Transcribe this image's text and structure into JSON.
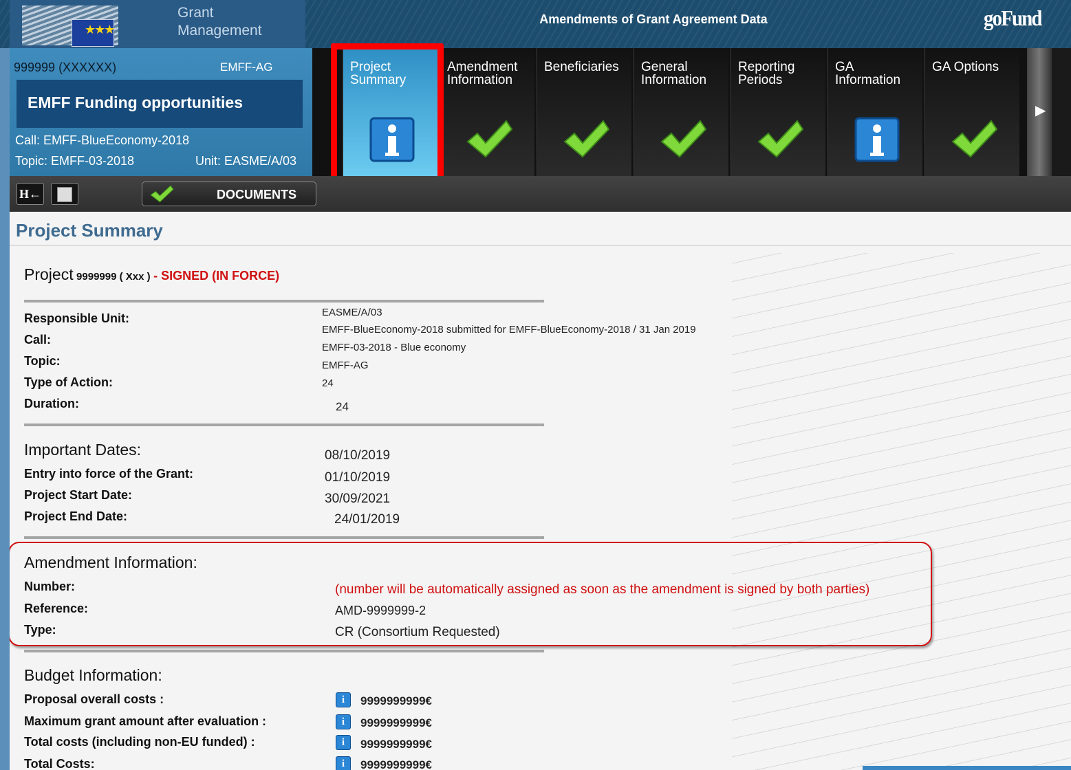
{
  "header": {
    "app_title_line1": "Grant",
    "app_title_line2": "Management",
    "page_heading": "Amendments of Grant Agreement Data",
    "brand_logo": "goFund"
  },
  "project_box": {
    "id": "999999 (XXXXXX)",
    "programme": "EMFF-AG",
    "title": "EMFF  Funding opportunities",
    "call": "Call: EMFF-BlueEconomy-2018",
    "topic": "Topic: EMFF-03-2018",
    "unit": "Unit: EASME/A/03"
  },
  "steps": [
    {
      "line1": "Project",
      "line2": "Summary",
      "icon": "info-icon",
      "active": true
    },
    {
      "line1": "Amendment",
      "line2": "Information",
      "icon": "check-icon",
      "active": false
    },
    {
      "line1": "Beneficiaries",
      "line2": "",
      "icon": "check-icon",
      "active": false
    },
    {
      "line1": "General",
      "line2": "Information",
      "icon": "check-icon",
      "active": false
    },
    {
      "line1": "Reporting",
      "line2": "Periods",
      "icon": "check-icon",
      "active": false
    },
    {
      "line1": "GA",
      "line2": "Information",
      "icon": "info-icon",
      "active": false
    },
    {
      "line1": "GA Options",
      "line2": "",
      "icon": "check-icon",
      "active": false
    }
  ],
  "toolbar": {
    "home_label": "H←",
    "documents_label": "DOCUMENTS"
  },
  "summary": {
    "section_title": "Project Summary",
    "project_word": "Project",
    "project_number": "9999999 ( Xxx )",
    "project_status": " - SIGNED (IN FORCE)",
    "general_labels": [
      "Responsible Unit:",
      "Call:",
      "Topic:",
      "Type of Action:",
      "Duration:"
    ],
    "general_values": [
      "EASME/A/03",
      "EMFF-BlueEconomy-2018 submitted for EMFF-BlueEconomy-2018 / 31 Jan 2019",
      "EMFF-03-2018 - Blue economy",
      "EMFF-AG",
      "24",
      "24"
    ],
    "dates_header": "Important Dates:",
    "dates_labels": [
      "Entry into force of the Grant:",
      "Project Start Date:",
      "Project End Date:"
    ],
    "dates_values": [
      "08/10/2019",
      "01/10/2019",
      "30/09/2021",
      "24/01/2019"
    ],
    "amend_header": "Amendment Information:",
    "amend_labels": [
      "Number:",
      "Reference:",
      "Type:"
    ],
    "amend_number_note": "(number will be automatically assigned as soon as the amendment is signed by both parties)",
    "amend_reference": "AMD-9999999-2",
    "amend_type": "CR (Consortium Requested)",
    "budget_header": "Budget Information:",
    "budget_labels": [
      "Proposal overall costs :",
      "Maximum grant amount after evaluation :",
      "Total costs (including non-EU funded) :",
      "Total Costs:"
    ],
    "budget_values": [
      "9999999999€",
      "9999999999€",
      "9999999999€",
      "9999999999€"
    ]
  },
  "colors": {
    "header_bg": "#1d4d6e",
    "project_box_bg": "#3d87b6",
    "active_step_bg": "#6ccbf0",
    "highlight_red": "#ff0000",
    "status_red": "#d01010",
    "section_title": "#3f6b90"
  }
}
